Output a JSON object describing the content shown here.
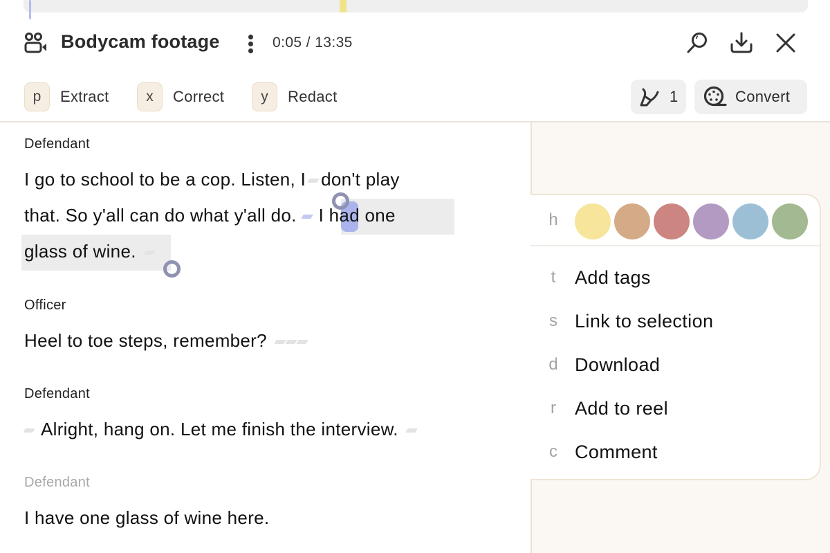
{
  "header": {
    "title": "Bodycam footage",
    "time_current": "0:05",
    "time_separator": " / ",
    "time_total": "13:35",
    "icons": {
      "media": "video-people-icon",
      "more": "more-vertical-icon",
      "search": "search-icon",
      "download": "download-icon",
      "close": "close-icon"
    }
  },
  "toolbar": {
    "tools": [
      {
        "key": "p",
        "label": "Extract"
      },
      {
        "key": "x",
        "label": "Correct"
      },
      {
        "key": "y",
        "label": "Redact"
      }
    ],
    "highlights_count": "1",
    "highlights_icon": "highlighter-icon",
    "convert_label": "Convert",
    "convert_icon": "film-reel-icon"
  },
  "transcript": {
    "segments": [
      {
        "speaker": "Defendant",
        "lines": [
          "I go to school to be a cop. Listen, I",
          "don't play",
          "that. So y'all can do what y'all do.",
          "I had one",
          "glass of wine."
        ]
      },
      {
        "speaker": "Officer",
        "lines": [
          "Heel to toe steps, remember?"
        ]
      },
      {
        "speaker": "Defendant",
        "lines": [
          "Alright, hang on. Let me finish the interview."
        ]
      },
      {
        "speaker": "Defendant",
        "lines": [
          "I have one glass of wine here."
        ]
      }
    ]
  },
  "context_menu": {
    "highlight_key": "h",
    "colors": [
      {
        "name": "yellow",
        "hex": "#f6e59a"
      },
      {
        "name": "tan",
        "hex": "#d5aa86"
      },
      {
        "name": "red",
        "hex": "#cc8580"
      },
      {
        "name": "purple",
        "hex": "#b39ac2"
      },
      {
        "name": "blue",
        "hex": "#9cbfd6"
      },
      {
        "name": "green",
        "hex": "#a2b992"
      }
    ],
    "items": [
      {
        "key": "t",
        "label": "Add tags"
      },
      {
        "key": "s",
        "label": "Link to selection"
      },
      {
        "key": "d",
        "label": "Download"
      },
      {
        "key": "r",
        "label": "Add to reel"
      },
      {
        "key": "c",
        "label": "Comment"
      }
    ]
  }
}
